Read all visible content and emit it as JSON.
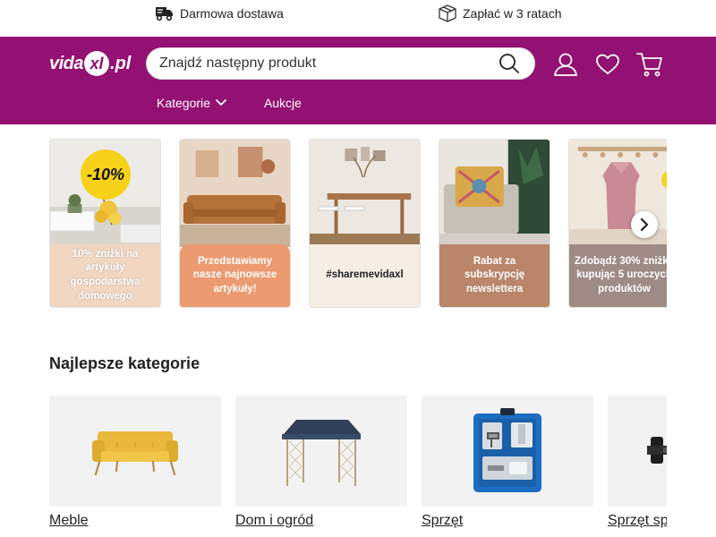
{
  "topbar": {
    "usp": [
      {
        "icon": "truck-icon",
        "label": "Darmowa dostawa"
      },
      {
        "icon": "box-icon",
        "label": "Zapłać w 3 ratach"
      }
    ]
  },
  "header": {
    "logo": {
      "part1": "vida",
      "badge": "xl",
      "part2": ".pl"
    },
    "search": {
      "placeholder": "Znajdź następny produkt"
    },
    "icons": [
      "user-icon",
      "heart-icon",
      "cart-icon"
    ],
    "nav": [
      {
        "label": "Kategorie",
        "has_dropdown": true
      },
      {
        "label": "Aukcje",
        "has_dropdown": false
      }
    ]
  },
  "banners": [
    {
      "caption": "10% zniżki na artykuły gospodarstwa domowego",
      "badge": "-10%",
      "caption_bg": "#f1d6c2"
    },
    {
      "caption": "Przedstawiamy nasze najnowsze artykuły!",
      "caption_bg": "#ec9a70"
    },
    {
      "caption": "#sharemevidaxl",
      "caption_bg": "#f6ede5"
    },
    {
      "caption": "Rabat za subskrypcję newslettera",
      "caption_bg": "#b9866a"
    },
    {
      "caption": "Zdobądź 30% zniżki, kupując 5 uroczych produktów",
      "badge": "%",
      "caption_bg": "#9e8b86"
    }
  ],
  "section": {
    "title": "Najlepsze kategorie"
  },
  "categories": [
    {
      "label": "Meble",
      "icon": "sofa-icon"
    },
    {
      "label": "Dom i ogród",
      "icon": "gazebo-icon"
    },
    {
      "label": "Sprzęt",
      "icon": "spray-gun-kit-icon"
    },
    {
      "label": "Sprzęt sp",
      "icon": "gym-equipment-icon"
    }
  ],
  "colors": {
    "brand": "#931173",
    "badge_yellow": "#f6d21b"
  }
}
